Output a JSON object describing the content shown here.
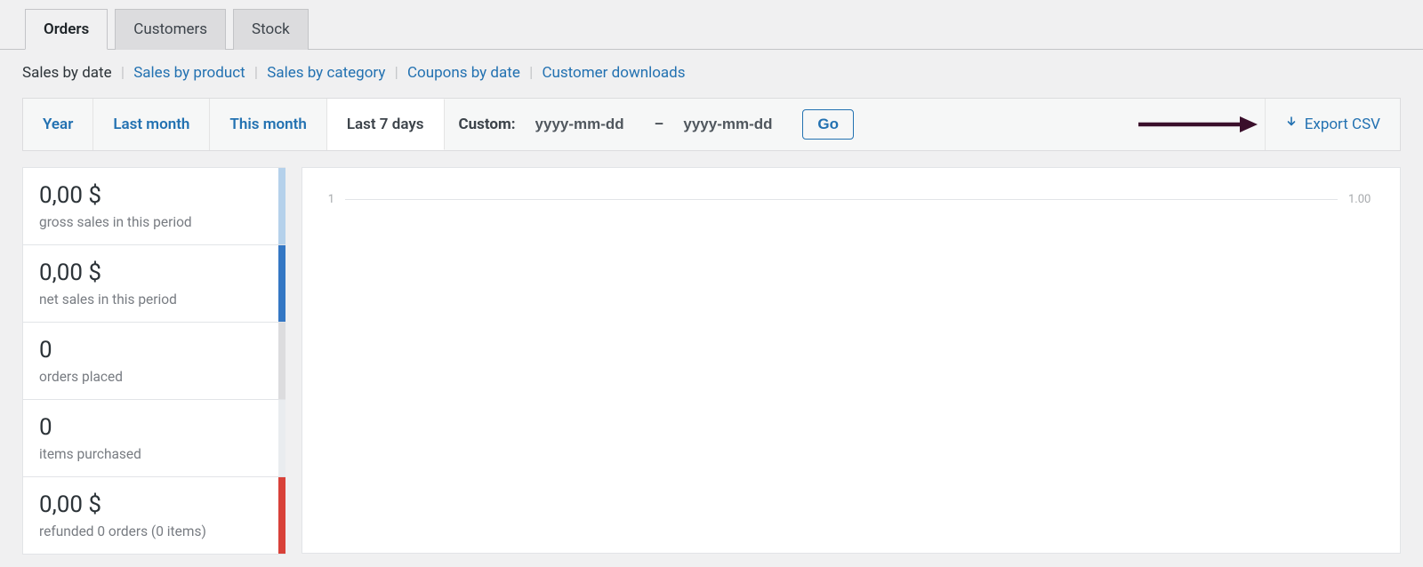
{
  "top_tabs": {
    "items": [
      {
        "label": "Orders",
        "active": true
      },
      {
        "label": "Customers",
        "active": false
      },
      {
        "label": "Stock",
        "active": false
      }
    ]
  },
  "subnav": {
    "current": "Sales by date",
    "links": [
      "Sales by product",
      "Sales by category",
      "Coupons by date",
      "Customer downloads"
    ]
  },
  "range": {
    "items": [
      {
        "label": "Year",
        "active": false
      },
      {
        "label": "Last month",
        "active": false
      },
      {
        "label": "This month",
        "active": false
      },
      {
        "label": "Last 7 days",
        "active": true
      }
    ],
    "custom_label": "Custom:",
    "date_from_placeholder": "yyyy-mm-dd",
    "date_sep": "–",
    "date_to_placeholder": "yyyy-mm-dd",
    "go_label": "Go"
  },
  "export": {
    "label": "Export CSV"
  },
  "stats": [
    {
      "value": "0,00 $",
      "label": "gross sales in this period",
      "stripe": "#b5d1eb"
    },
    {
      "value": "0,00 $",
      "label": "net sales in this period",
      "stripe": "#3477c4"
    },
    {
      "value": "0",
      "label": "orders placed",
      "stripe": "#dcdcde"
    },
    {
      "value": "0",
      "label": "items purchased",
      "stripe": "#e9ecef"
    },
    {
      "value": "0,00 $",
      "label": "refunded 0 orders (0 items)",
      "stripe": "#d84139"
    }
  ],
  "chart_data": {
    "type": "line",
    "y_left_tick": "1",
    "y_right_tick": "1.00",
    "title": "",
    "xlabel": "",
    "ylabel": "",
    "series": []
  }
}
